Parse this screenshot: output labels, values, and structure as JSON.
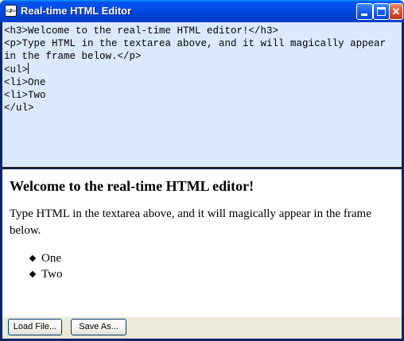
{
  "window": {
    "title": "Real-time HTML Editor",
    "app_icon_glyph": "<#>",
    "controls": {
      "minimize": "minimize-icon",
      "maximize": "maximize-icon",
      "close": "close-icon",
      "close_glyph": "✕"
    }
  },
  "editor": {
    "lines": [
      "<h3>Welcome to the real-time HTML editor!</h3>",
      "<p>Type HTML in the textarea above, and it will magically appear in the frame below.</p>",
      "<ul>",
      "<li>One",
      "<li>Two",
      "</ul>"
    ]
  },
  "preview": {
    "heading": "Welcome to the real-time HTML editor!",
    "paragraph": "Type HTML in the textarea above, and it will magically appear in the frame below.",
    "list": [
      "One",
      "Two"
    ]
  },
  "buttons": {
    "load": "Load File...",
    "save": "Save As..."
  },
  "colors": {
    "titlebar": "#0053ee",
    "editor_bg": "#dbe9fe",
    "preview_bg": "#ffffff",
    "chrome": "#ece9d8"
  }
}
